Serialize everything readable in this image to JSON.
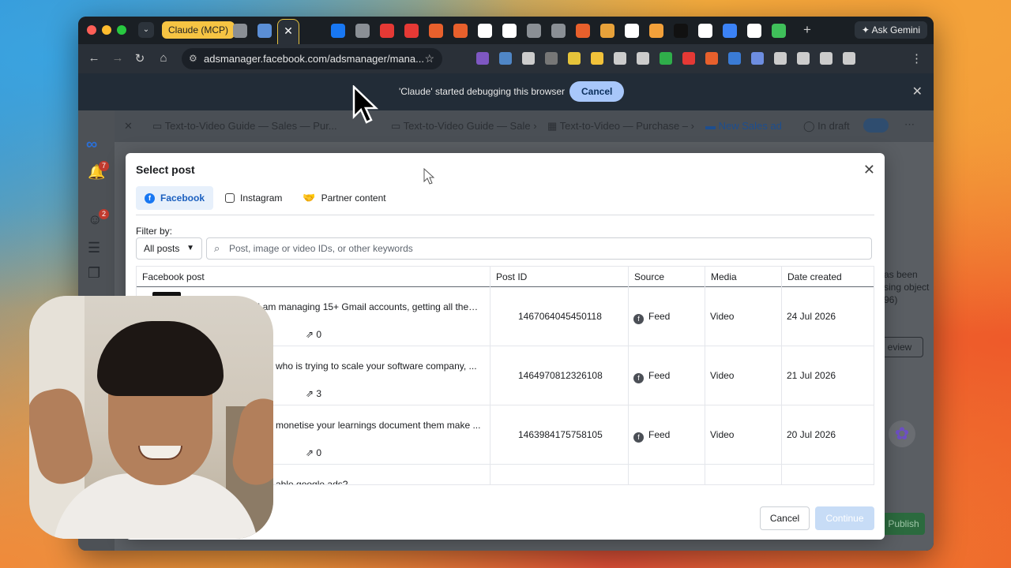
{
  "browser": {
    "active_tab_label": "Claude (MCP)",
    "ask_gemini_label": "Ask Gemini",
    "url": "adsmanager.facebook.com/adsmanager/mana...",
    "tab_favicon_colors": [
      "#8a8f95",
      "#5b8fd6",
      "#8a8f95",
      "#1877f2",
      "#8a8f95",
      "#e53935",
      "#e53935",
      "#e8602c",
      "#e8602c",
      "#ffffff",
      "#ffffff",
      "#8a8f95",
      "#8a8f95",
      "#e8602c",
      "#e8a23a",
      "#ffffff",
      "#f2a03a",
      "#111111",
      "#ffffff",
      "#3b82f6",
      "#ffffff",
      "#3fbf5a"
    ],
    "extension_colors": [
      "#7e57c2",
      "#4f86c6",
      "#cccccc",
      "#777777",
      "#e6c43a",
      "#f2c23a",
      "#cccccc",
      "#cccccc",
      "#2fae4a",
      "#e53935",
      "#e8602c",
      "#3a7bd5",
      "#6d8de0",
      "#cccccc",
      "#cccccc",
      "#cccccc",
      "#cccccc"
    ]
  },
  "debug_bar": {
    "message": "'Claude' started debugging this browser",
    "cancel_label": "Cancel"
  },
  "background_page": {
    "breadcrumb_1": "Text-to-Video Guide — Sales — Pur...",
    "breadcrumb_2": "Text-to-Video Guide — Sale",
    "breadcrumb_3": "Text-to-Video — Purchase –",
    "breadcrumb_4": "New Sales ad",
    "status": "In draft",
    "notification_count_1": "7",
    "notification_count_2": "2",
    "side_text_1": "as been",
    "side_text_2": "sing object",
    "side_text_3": "96)",
    "review_label": "eview",
    "publish_label": "Publish"
  },
  "modal": {
    "title": "Select post",
    "tabs": [
      {
        "label": "Facebook",
        "icon": "facebook-icon"
      },
      {
        "label": "Instagram",
        "icon": "instagram-icon"
      },
      {
        "label": "Partner content",
        "icon": "handshake-icon"
      }
    ],
    "filter_label": "Filter by:",
    "filter_value": "All posts",
    "search_placeholder": "Post, image or video IDs, or other keywords",
    "columns": [
      "Facebook post",
      "Post ID",
      "Source",
      "Media",
      "Date created"
    ],
    "rows": [
      {
        "caption": "So here's how I am managing 15+ Gmail accounts, getting all the s...",
        "share_count": "0",
        "post_id": "1467064045450118",
        "source": "Feed",
        "media": "Video",
        "date": "24 Jul 2026"
      },
      {
        "caption": "who is trying to scale your software company, ...",
        "share_count": "3",
        "post_id": "1464970812326108",
        "source": "Feed",
        "media": "Video",
        "date": "21 Jul 2026"
      },
      {
        "caption": "monetise your learnings document them make ...",
        "share_count": "0",
        "post_id": "1463984175758105",
        "source": "Feed",
        "media": "Video",
        "date": "20 Jul 2026"
      },
      {
        "caption": "able google ads?",
        "share_count": "",
        "post_id": "",
        "source": "",
        "media": "",
        "date": ""
      }
    ],
    "cancel_label": "Cancel",
    "continue_label": "Continue"
  }
}
